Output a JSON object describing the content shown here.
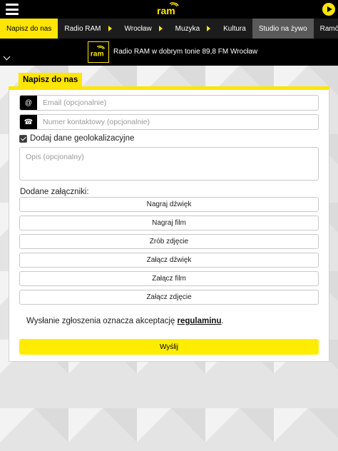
{
  "header": {
    "logo_text": "ram",
    "logo_alt": "Radio RAM"
  },
  "nav": {
    "items": [
      {
        "label": "Napisz do nas",
        "active": true,
        "arrow": false
      },
      {
        "label": "Radio RAM",
        "active": false,
        "arrow": true
      },
      {
        "label": "Wrocław",
        "active": false,
        "arrow": true
      },
      {
        "label": "Muzyka",
        "active": false,
        "arrow": true
      },
      {
        "label": "Kultura",
        "active": false,
        "arrow": false
      },
      {
        "label": "Studio na żywo",
        "active": false,
        "arrow": false
      },
      {
        "label": "Ramówka",
        "active": false,
        "arrow": false
      }
    ]
  },
  "now_playing": {
    "text": "Radio RAM w dobrym tonie 89,8 FM Wrocław"
  },
  "form": {
    "tab_title": "Napisz do nas",
    "email": {
      "placeholder": "Email (opcjonalnie)",
      "value": "",
      "addon": "@"
    },
    "phone": {
      "placeholder": "Numer kontaktowy (opcjonalnie)",
      "value": "",
      "addon": "☎"
    },
    "geo_label": "Dodaj dane geolokalizacyjne",
    "geo_checked": true,
    "description_placeholder": "Opis (opcjonalny)",
    "attachments_label": "Dodane załączniki:",
    "buttons": {
      "record_audio": "Nagraj dźwięk",
      "record_video": "Nagraj film",
      "take_photo": "Zrób zdjęcie",
      "attach_audio": "Załącz dźwięk",
      "attach_video": "Załącz film",
      "attach_photo": "Załącz zdjęcie"
    },
    "terms_prefix": "Wysłanie zgłoszenia oznacza akceptację ",
    "terms_link": "regulaminu",
    "terms_suffix": ".",
    "submit": "Wyślij"
  },
  "colors": {
    "accent": "#ffe500",
    "bar": "#000000",
    "nav": "#1c1c1c"
  }
}
